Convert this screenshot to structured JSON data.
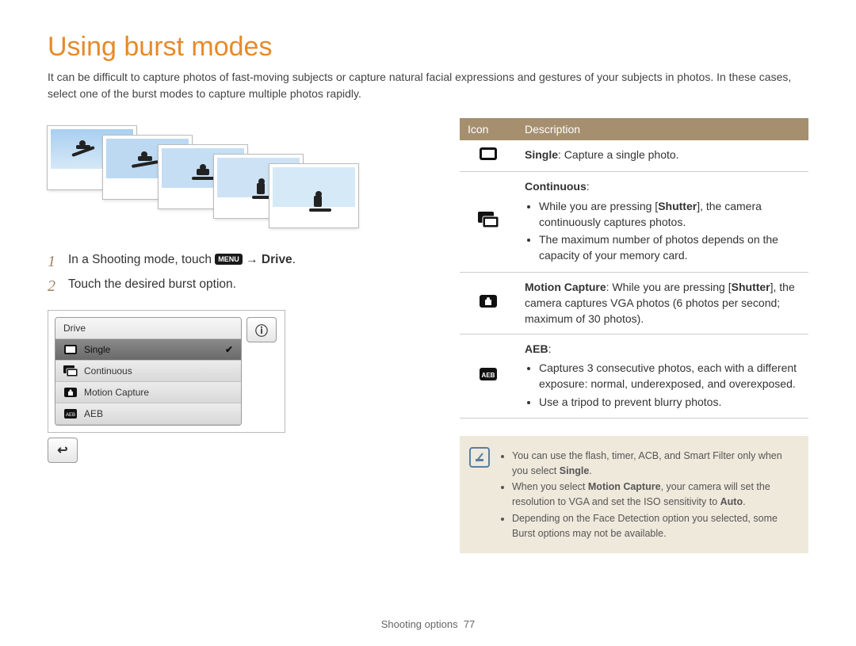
{
  "title": "Using burst modes",
  "intro": "It can be difficult to capture photos of fast-moving subjects or capture natural facial expressions and gestures of your subjects in photos. In these cases, select one of the burst modes to capture multiple photos rapidly.",
  "steps": [
    {
      "num": "1",
      "pre": "In a Shooting mode, touch ",
      "chip": "MENU",
      "post": " → ",
      "bold": "Drive",
      "tail": "."
    },
    {
      "num": "2",
      "pre": "Touch the desired burst option.",
      "chip": "",
      "post": "",
      "bold": "",
      "tail": ""
    }
  ],
  "ui": {
    "header": "Drive",
    "items": [
      {
        "label": "Single",
        "selected": true
      },
      {
        "label": "Continuous",
        "selected": false
      },
      {
        "label": "Motion Capture",
        "selected": false
      },
      {
        "label": "AEB",
        "selected": false
      }
    ],
    "info_icon": "ⓘ",
    "back_icon": "↩"
  },
  "table": {
    "headers": {
      "icon": "Icon",
      "desc": "Description"
    },
    "rows": [
      {
        "icon": "single",
        "title": "Single",
        "after_title": ": Capture a single photo.",
        "bullets": []
      },
      {
        "icon": "continuous",
        "title": "Continuous",
        "after_title": ":",
        "bullets": [
          "While you are pressing [Shutter], the camera continuously captures photos.",
          "The maximum number of photos depends on the capacity of your memory card."
        ],
        "bold_inside": {
          "0": "Shutter"
        }
      },
      {
        "icon": "motion",
        "title": "Motion Capture",
        "after_title": ": While you are pressing [",
        "bold2": "Shutter",
        "after_bold2": "], the camera captures VGA photos (6 photos per second; maximum of 30 photos).",
        "bullets": []
      },
      {
        "icon": "aeb",
        "title": "AEB",
        "after_title": ":",
        "bullets": [
          "Captures 3 consecutive photos, each with a different exposure: normal, underexposed, and overexposed.",
          "Use a tripod to prevent blurry photos."
        ]
      }
    ]
  },
  "note": {
    "bullets": [
      {
        "pre": "You can use the flash, timer, ACB, and Smart Filter only when you select ",
        "bold": "Single",
        "post": "."
      },
      {
        "pre": "When you select ",
        "bold": "Motion Capture",
        "post": ", your camera will set the resolution to VGA and set the ISO sensitivity to ",
        "bold2": "Auto",
        "post2": "."
      },
      {
        "pre": "Depending on the Face Detection option you selected, some Burst options may not be available.",
        "bold": "",
        "post": ""
      }
    ]
  },
  "footer": {
    "section": "Shooting options",
    "page": "77"
  }
}
